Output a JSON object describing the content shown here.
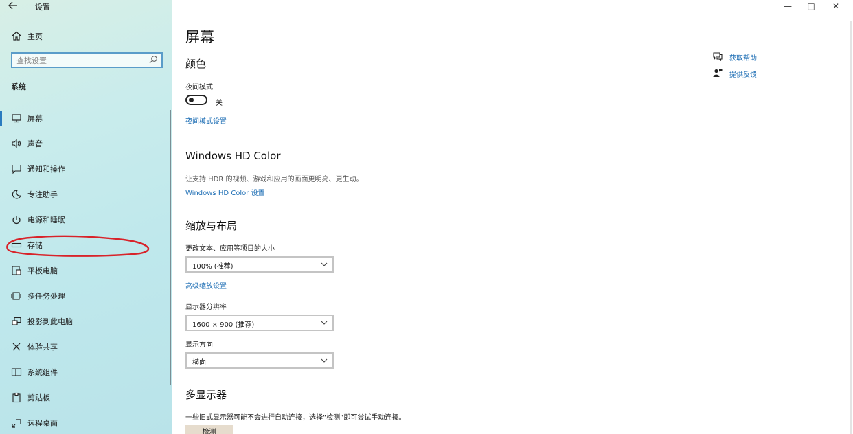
{
  "window": {
    "title": "设置",
    "controls": {
      "minimize": "—",
      "maximize": "□",
      "close": "✕"
    }
  },
  "sidebar": {
    "back_icon": "arrow-left-icon",
    "home_label": "主页",
    "search_placeholder": "查找设置",
    "section_title": "系统",
    "items": [
      {
        "label": "屏幕",
        "icon": "monitor-icon",
        "active": true
      },
      {
        "label": "声音",
        "icon": "speaker-icon"
      },
      {
        "label": "通知和操作",
        "icon": "notification-icon"
      },
      {
        "label": "专注助手",
        "icon": "moon-icon"
      },
      {
        "label": "电源和睡眠",
        "icon": "power-icon"
      },
      {
        "label": "存储",
        "icon": "storage-icon",
        "annotated": true
      },
      {
        "label": "平板电脑",
        "icon": "tablet-icon"
      },
      {
        "label": "多任务处理",
        "icon": "multitask-icon"
      },
      {
        "label": "投影到此电脑",
        "icon": "project-icon"
      },
      {
        "label": "体验共享",
        "icon": "share-icon"
      },
      {
        "label": "系统组件",
        "icon": "components-icon"
      },
      {
        "label": "剪贴板",
        "icon": "clipboard-icon"
      },
      {
        "label": "远程桌面",
        "icon": "remote-desktop-icon"
      }
    ],
    "annotation_color": "#d8232a"
  },
  "main": {
    "title": "屏幕",
    "color_section": {
      "heading": "颜色",
      "night_light_label": "夜间模式",
      "night_light_state": "关",
      "night_light_link": "夜间模式设置"
    },
    "hdr_section": {
      "heading": "Windows HD Color",
      "description": "让支持 HDR 的视频、游戏和应用的画面更明亮、更生动。",
      "link": "Windows HD Color 设置"
    },
    "scale_section": {
      "heading": "缩放与布局",
      "scale_label": "更改文本、应用等项目的大小",
      "scale_value": "100% (推荐)",
      "advanced_link": "高级缩放设置",
      "resolution_label": "显示器分辨率",
      "resolution_value": "1600 × 900 (推荐)",
      "orientation_label": "显示方向",
      "orientation_value": "横向"
    },
    "multi_display": {
      "heading": "多显示器",
      "description": "一些旧式显示器可能不会进行自动连接，选择“检测”即可尝试手动连接。",
      "detect_button": "检测"
    },
    "help": {
      "get_help": "获取帮助",
      "feedback": "提供反馈"
    }
  },
  "colors": {
    "accent": "#2a7bbf",
    "link": "#1f6fb5",
    "sidebar_bg": "#c6ebea"
  }
}
